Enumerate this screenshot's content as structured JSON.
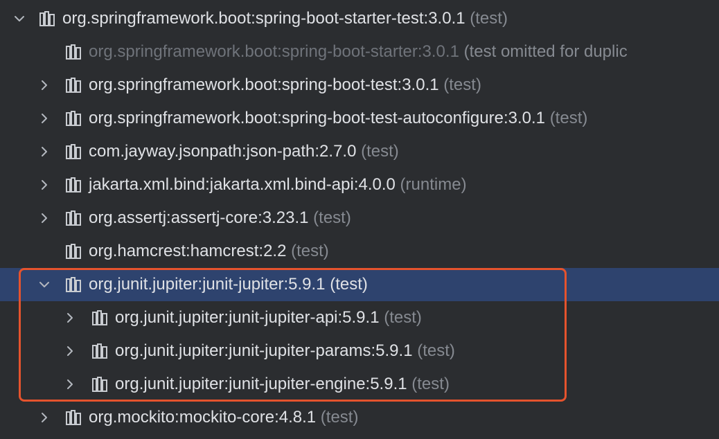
{
  "tree": {
    "rows": [
      {
        "name": "org.springframework.boot:spring-boot-starter-test:3.0.1",
        "scope": "(test)",
        "expander": "chevron-down"
      },
      {
        "name": "org.springframework.boot:spring-boot-starter:3.0.1",
        "scope": "(test omitted for duplic",
        "expander": "none"
      },
      {
        "name": "org.springframework.boot:spring-boot-test:3.0.1",
        "scope": "(test)",
        "expander": "chevron-right"
      },
      {
        "name": "org.springframework.boot:spring-boot-test-autoconfigure:3.0.1",
        "scope": "(test)",
        "expander": "chevron-right"
      },
      {
        "name": "com.jayway.jsonpath:json-path:2.7.0",
        "scope": "(test)",
        "expander": "chevron-right"
      },
      {
        "name": "jakarta.xml.bind:jakarta.xml.bind-api:4.0.0",
        "scope": "(runtime)",
        "expander": "chevron-right"
      },
      {
        "name": "org.assertj:assertj-core:3.23.1",
        "scope": "(test)",
        "expander": "chevron-right"
      },
      {
        "name": "org.hamcrest:hamcrest:2.2",
        "scope": "(test)",
        "expander": "none"
      },
      {
        "name": "org.junit.jupiter:junit-jupiter:5.9.1",
        "scope": "(test)",
        "expander": "chevron-down"
      },
      {
        "name": "org.junit.jupiter:junit-jupiter-api:5.9.1",
        "scope": "(test)",
        "expander": "chevron-right"
      },
      {
        "name": "org.junit.jupiter:junit-jupiter-params:5.9.1",
        "scope": "(test)",
        "expander": "chevron-right"
      },
      {
        "name": "org.junit.jupiter:junit-jupiter-engine:5.9.1",
        "scope": "(test)",
        "expander": "chevron-right"
      },
      {
        "name": "org.mockito:mockito-core:4.8.1",
        "scope": "(test)",
        "expander": "chevron-right"
      }
    ]
  },
  "icons": {
    "library": "library-icon",
    "expand": "chevron-right-icon",
    "collapse": "chevron-down-icon"
  },
  "colors": {
    "background": "#2b2d30",
    "selection": "#2e436e",
    "text": "#dfe1e5",
    "scope_text": "#868a91",
    "dimmed_text": "#6f737a",
    "highlight_border": "#e5532d"
  }
}
